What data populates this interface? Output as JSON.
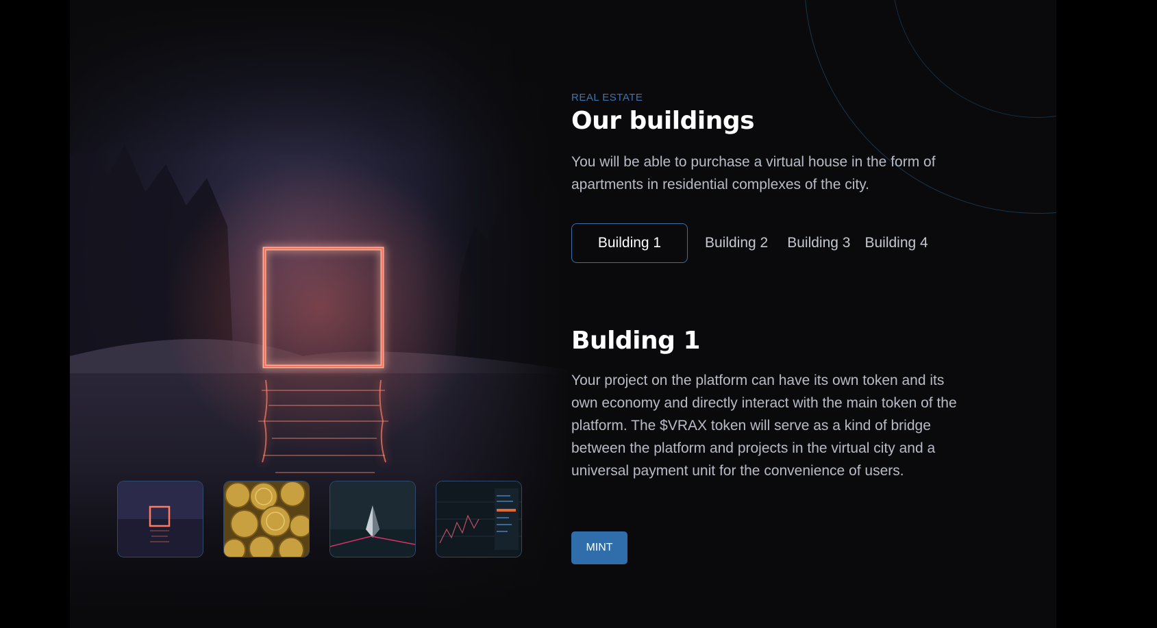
{
  "section": {
    "eyebrow": "REAL ESTATE",
    "title": "Our buildings",
    "lead": "You will be able to purchase a virtual house in the form of apartments in residential complexes of the city."
  },
  "tabs": [
    {
      "label": "Building 1",
      "active": true
    },
    {
      "label": "Building 2",
      "active": false
    },
    {
      "label": "Building 3",
      "active": false
    },
    {
      "label": "Building 4",
      "active": false
    }
  ],
  "detail": {
    "title": "Bulding 1",
    "body": "Your project on the platform can have its own token and its own economy and directly interact with the main token of the platform. The $VRAX token will serve as a kind of bridge between the platform and projects in the virtual city and a universal payment unit for the convenience of users.",
    "cta_label": "MINT"
  },
  "gallery": {
    "thumbnails": [
      {
        "name": "neon-portal-thumbnail"
      },
      {
        "name": "crypto-coins-thumbnail"
      },
      {
        "name": "ethereum-crystal-thumbnail"
      },
      {
        "name": "trading-chart-thumbnail"
      }
    ]
  },
  "colors": {
    "background": "#0a0a0c",
    "accent": "#2f6eab",
    "eyebrow": "#3b76b3",
    "text_muted": "#b8bcc6",
    "neon": "#ff6a55"
  }
}
